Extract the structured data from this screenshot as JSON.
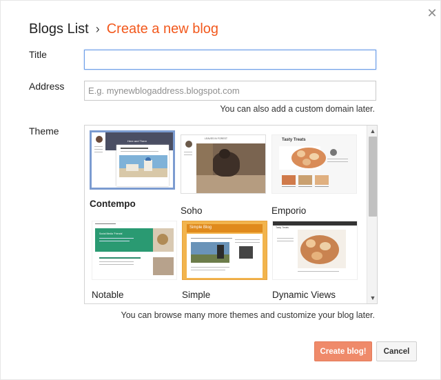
{
  "dialog": {
    "close_icon": "close-icon",
    "breadcrumb": {
      "root": "Blogs List",
      "separator": "›",
      "current": "Create a new blog"
    },
    "fields": {
      "title_label": "Title",
      "title_value": "",
      "address_label": "Address",
      "address_placeholder": "E.g. mynewblogaddress.blogspot.com",
      "domain_hint": "You can also add a custom domain later.",
      "theme_label": "Theme"
    },
    "themes": [
      {
        "name": "Contempo",
        "selected": true,
        "thumb_title": "Here and There"
      },
      {
        "name": "Soho",
        "selected": false,
        "thumb_title": "LEAVES IN FOREST"
      },
      {
        "name": "Emporio",
        "selected": false,
        "thumb_title": "Tasty Treats"
      },
      {
        "name": "Notable",
        "selected": false,
        "thumb_title": "Social Media 'Friends'"
      },
      {
        "name": "Simple",
        "selected": false,
        "thumb_title": "Simple Blog"
      },
      {
        "name": "Dynamic Views",
        "selected": false,
        "thumb_title": "Tasty Treats"
      }
    ],
    "themes_hint": "You can browse many more themes and customize your blog later.",
    "buttons": {
      "create": "Create blog!",
      "cancel": "Cancel"
    },
    "colors": {
      "accent": "#f2581c",
      "create_button": "#ef8a6a",
      "focus_border": "#6b9de8",
      "selected_theme_border": "#7b9bd0"
    }
  }
}
